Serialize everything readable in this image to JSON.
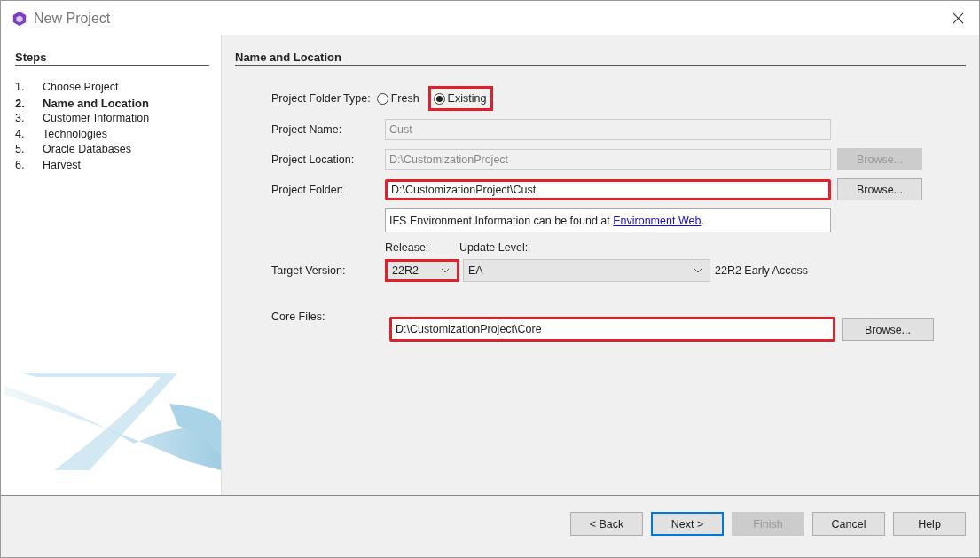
{
  "window": {
    "title": "New Project"
  },
  "steps": {
    "title": "Steps",
    "items": [
      {
        "number": "1.",
        "label": "Choose Project",
        "selected": false
      },
      {
        "number": "2.",
        "label": "Name and Location",
        "selected": true
      },
      {
        "number": "3.",
        "label": "Customer Information",
        "selected": false
      },
      {
        "number": "4.",
        "label": "Technologies",
        "selected": false
      },
      {
        "number": "5.",
        "label": "Oracle Databases",
        "selected": false
      },
      {
        "number": "6.",
        "label": "Harvest",
        "selected": false
      }
    ]
  },
  "panel": {
    "title": "Name and Location"
  },
  "folder_type": {
    "label": "Project Folder Type:",
    "options": [
      {
        "label": "Fresh",
        "selected": false,
        "highlighted": false
      },
      {
        "label": "Existing",
        "selected": true,
        "highlighted": true
      }
    ]
  },
  "fields": [
    {
      "label": "Project Name:",
      "value": "Cust",
      "disabled": true,
      "highlighted": false
    },
    {
      "label": "Project Location:",
      "value": "D:\\CustomizationProject",
      "disabled": true,
      "highlighted": false,
      "browse": {
        "label": "Browse...",
        "disabled": true
      }
    },
    {
      "label": "Project Folder:",
      "value": "D:\\CustomizationProject\\Cust",
      "disabled": false,
      "highlighted": true,
      "browse": {
        "label": "Browse...",
        "disabled": false
      }
    }
  ],
  "info": {
    "text": "IFS Environment Information can be found at ",
    "link": "Environment Web",
    "suffix": "."
  },
  "target_version": {
    "label": "Target Version:",
    "release_label": "Release:",
    "update_label": "Update Level:",
    "release": {
      "value": "22R2",
      "highlighted": true
    },
    "update_level": {
      "value": "EA"
    },
    "description": "22R2 Early Access"
  },
  "core_files": {
    "label": "Core Files:",
    "value": "D:\\CustomizationProject\\Core",
    "highlighted": true,
    "browse": {
      "label": "Browse...",
      "disabled": false
    }
  },
  "buttons": [
    {
      "label": "< Back",
      "disabled": false,
      "default": false
    },
    {
      "label": "Next >",
      "disabled": false,
      "default": true
    },
    {
      "label": "Finish",
      "disabled": true,
      "default": false
    },
    {
      "label": "Cancel",
      "disabled": false,
      "default": false
    },
    {
      "label": "Help",
      "disabled": false,
      "default": false
    }
  ]
}
